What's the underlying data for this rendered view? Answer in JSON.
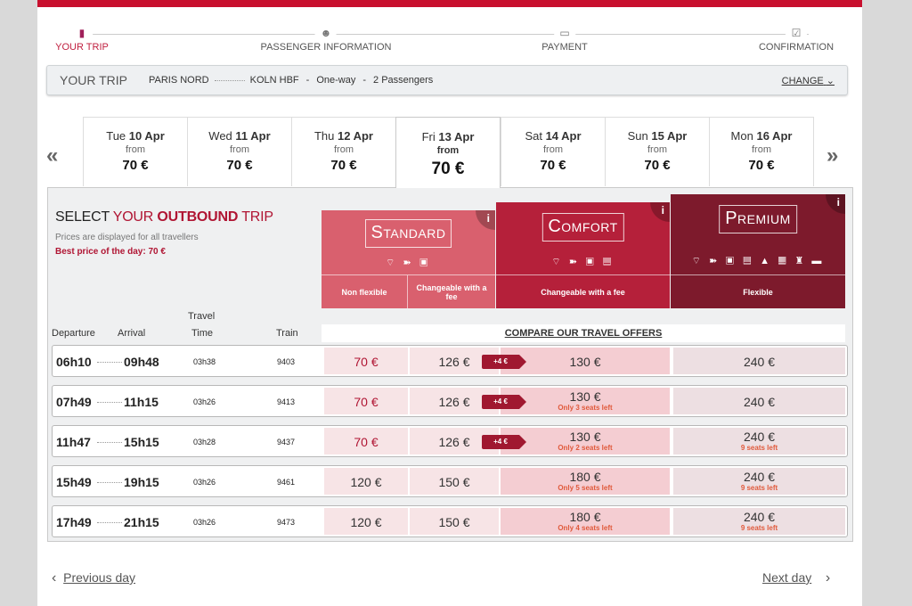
{
  "steps": [
    {
      "label": "YOUR TRIP",
      "icon": "luggage-icon",
      "active": true
    },
    {
      "label": "PASSENGER INFORMATION",
      "icon": "passengers-icon",
      "active": false
    },
    {
      "label": "PAYMENT",
      "icon": "card-icon",
      "active": false
    },
    {
      "label": "CONFIRMATION",
      "icon": "checkbox-icon",
      "active": false
    }
  ],
  "trip": {
    "title": "YOUR TRIP",
    "from": "PARIS NORD",
    "to": "KOLN HBF",
    "sep1": "-",
    "type": "One-way",
    "sep2": "-",
    "passengers": "2 Passengers",
    "change_label": "CHANGE"
  },
  "dates": [
    {
      "day": "Tue",
      "date": "10 Apr",
      "from": "from",
      "price": "70 €"
    },
    {
      "day": "Wed",
      "date": "11 Apr",
      "from": "from",
      "price": "70 €"
    },
    {
      "day": "Thu",
      "date": "12 Apr",
      "from": "from",
      "price": "70 €"
    },
    {
      "day": "Fri",
      "date": "13 Apr",
      "from": "from",
      "price": "70 €",
      "selected": true
    },
    {
      "day": "Sat",
      "date": "14 Apr",
      "from": "from",
      "price": "70 €"
    },
    {
      "day": "Sun",
      "date": "15 Apr",
      "from": "from",
      "price": "70 €"
    },
    {
      "day": "Mon",
      "date": "16 Apr",
      "from": "from",
      "price": "70 €"
    }
  ],
  "select": {
    "t1": "SELECT ",
    "t2": "YOUR ",
    "t3": "OUTBOUND",
    "t4": " TRIP",
    "subtitle": "Prices are displayed for all travellers",
    "best": "Best price of the day: 70 €"
  },
  "offers": {
    "standard": {
      "name": "Standard",
      "icons": "⌔ ➽ ▣",
      "sub1": "Non flexible",
      "sub2": "Changeable with a fee",
      "info": "i"
    },
    "comfort": {
      "name": "Comfort",
      "icons": "⌔ ➽ ▣ ▤",
      "sub": "Changeable with a fee",
      "info": "i"
    },
    "premium": {
      "name": "Premium",
      "icons": "⌔ ➽ ▣ ▤ ▲ ▦ ♜ ▬",
      "sub": "Flexible",
      "info": "i"
    }
  },
  "columns": {
    "departure": "Departure",
    "arrival": "Arrival",
    "travel1": "Travel",
    "travel2": "Time",
    "train": "Train",
    "compare": "COMPARE OUR TRAVEL OFFERS"
  },
  "rows": [
    {
      "dep": "06h10",
      "arr": "09h48",
      "time": "03h38",
      "train": "9403",
      "p1": "70 €",
      "p2": "126 €",
      "tag": "+4 €",
      "p3": "130 €",
      "n3": "",
      "p4": "240 €",
      "n4": ""
    },
    {
      "dep": "07h49",
      "arr": "11h15",
      "time": "03h26",
      "train": "9413",
      "p1": "70 €",
      "p2": "126 €",
      "tag": "+4 €",
      "p3": "130 €",
      "n3": "Only 3 seats left",
      "p4": "240 €",
      "n4": ""
    },
    {
      "dep": "11h47",
      "arr": "15h15",
      "time": "03h28",
      "train": "9437",
      "p1": "70 €",
      "p2": "126 €",
      "tag": "+4 €",
      "p3": "130 €",
      "n3": "Only 2 seats left",
      "p4": "240 €",
      "n4": "9 seats left"
    },
    {
      "dep": "15h49",
      "arr": "19h15",
      "time": "03h26",
      "train": "9461",
      "p1": "120 €",
      "p2": "150 €",
      "tag": "",
      "p3": "180 €",
      "n3": "Only 5 seats left",
      "p4": "240 €",
      "n4": "9 seats left"
    },
    {
      "dep": "17h49",
      "arr": "21h15",
      "time": "03h26",
      "train": "9473",
      "p1": "120 €",
      "p2": "150 €",
      "tag": "",
      "p3": "180 €",
      "n3": "Only 4 seats left",
      "p4": "240 €",
      "n4": "9 seats left"
    }
  ],
  "pager": {
    "prev": "Previous day",
    "next": "Next day"
  },
  "nav": {
    "prev_arrow": "«",
    "next_arrow": "»"
  },
  "colors": {
    "brand": "#c8102e",
    "standard": "#d9606e",
    "comfort": "#b5203a",
    "premium": "#7d1a2c"
  }
}
